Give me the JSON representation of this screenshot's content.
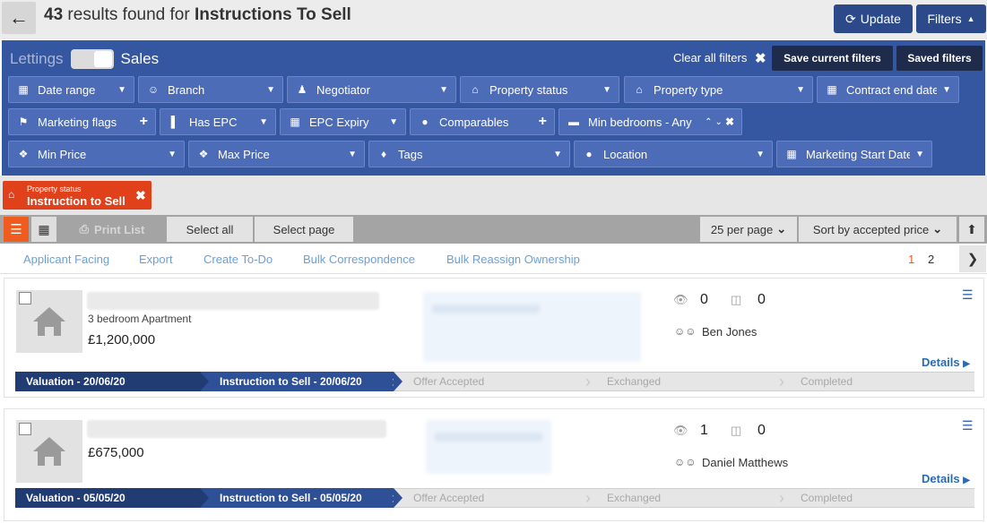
{
  "header": {
    "count": "43",
    "results_text": " results found for ",
    "query": "Instructions To Sell",
    "update_label": "Update",
    "filters_label": "Filters"
  },
  "filters": {
    "mode_left": "Lettings",
    "mode_right": "Sales",
    "clear_all": "Clear all filters",
    "save_current": "Save current filters",
    "saved_filters": "Saved filters",
    "row1": [
      "Date range",
      "Branch",
      "Negotiator",
      "Property status",
      "Property type",
      "Contract end date"
    ],
    "row2": [
      "Marketing flags",
      "Has EPC",
      "EPC Expiry",
      "Comparables",
      "Min bedrooms - Any"
    ],
    "row3": [
      "Min Price",
      "Max Price",
      "Tags",
      "Location",
      "Marketing Start Date"
    ]
  },
  "active_filter": {
    "label_small": "Property status",
    "label_big": "Instruction to Sell"
  },
  "toolbar": {
    "print_list": "Print List",
    "select_all": "Select all",
    "select_page": "Select page",
    "per_page": "25 per page",
    "sort_by": "Sort by accepted price"
  },
  "actions": {
    "applicant_facing": "Applicant Facing",
    "export": "Export",
    "create_todo": "Create To-Do",
    "bulk_correspondence": "Bulk Correspondence",
    "bulk_reassign": "Bulk Reassign Ownership",
    "page1": "1",
    "page2": "2"
  },
  "listings": [
    {
      "description": "3 bedroom Apartment",
      "price": "£1,200,000",
      "views": "0",
      "offers": "0",
      "negotiator": "Ben Jones",
      "details": "Details",
      "stages": [
        "Valuation - 20/06/20",
        "Instruction to Sell - 20/06/20",
        "Offer Accepted",
        "Exchanged",
        "Completed"
      ]
    },
    {
      "description": "",
      "price": "£675,000",
      "views": "1",
      "offers": "0",
      "negotiator": "Daniel Matthews",
      "details": "Details",
      "stages": [
        "Valuation - 05/05/20",
        "Instruction to Sell - 05/05/20",
        "Offer Accepted",
        "Exchanged",
        "Completed"
      ]
    }
  ],
  "colors": {
    "brand_blue": "#3556a0",
    "dark_blue": "#203c73",
    "accent_orange": "#f05c1e",
    "tag_red": "#e0411b"
  }
}
